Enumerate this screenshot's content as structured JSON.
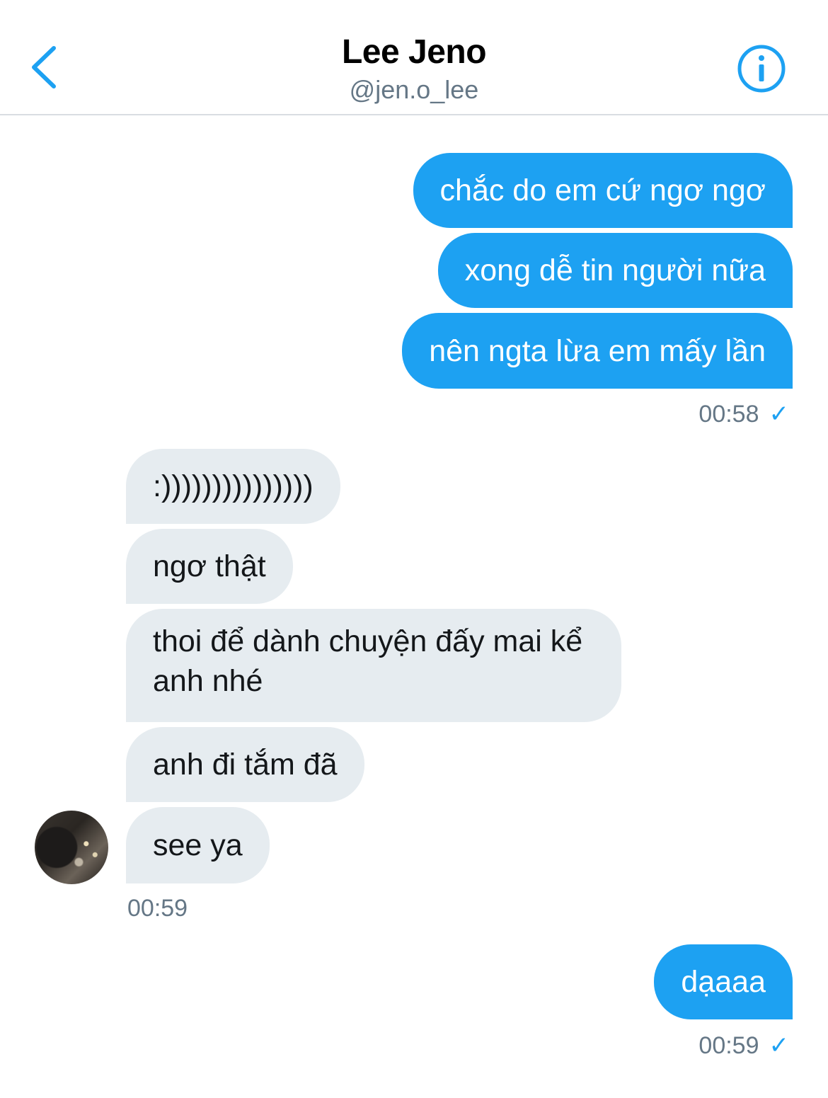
{
  "header": {
    "title": "Lee Jeno",
    "handle": "@jen.o_lee",
    "accent": "#1da1f2"
  },
  "messages": [
    {
      "side": "out",
      "text": "chắc do em cứ ngơ ngơ"
    },
    {
      "side": "out",
      "text": "xong dễ tin người nữa"
    },
    {
      "side": "out",
      "text": "nên ngta lừa em mấy lần"
    },
    {
      "side": "in",
      "text": ":)))))))))))))))"
    },
    {
      "side": "in",
      "text": "ngơ thật"
    },
    {
      "side": "in",
      "text": "thoi để dành chuyện đấy mai kể anh nhé"
    },
    {
      "side": "in",
      "text": "anh đi tắm đã"
    },
    {
      "side": "in",
      "text": "see ya"
    },
    {
      "side": "out",
      "text": "dạaaa"
    }
  ],
  "timestamps": [
    "00:58",
    "00:59",
    "00:59"
  ],
  "icons": {
    "back": "chevron-left-icon",
    "info": "info-icon",
    "read_receipt": "checkmark-icon"
  }
}
